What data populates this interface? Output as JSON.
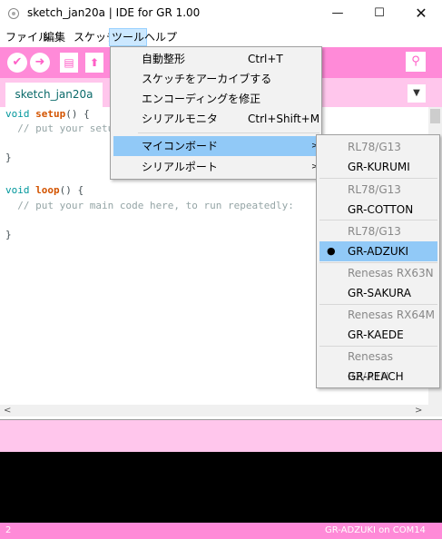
{
  "window": {
    "title": "sketch_jan20a | IDE for GR 1.00",
    "minimize_glyph": "—",
    "maximize_glyph": "☐",
    "close_glyph": "✕"
  },
  "menubar": {
    "items": [
      "ファイル",
      "編集",
      "スケッチ",
      "ツール",
      "ヘルプ"
    ],
    "active_index": 3
  },
  "toolbar": {
    "verify_glyph": "✔",
    "upload_glyph": "➜",
    "new_glyph": "▤",
    "open_glyph": "⬆",
    "serial_glyph": "⚲"
  },
  "tabs": {
    "active_tab": "sketch_jan20a",
    "menu_glyph": "▼"
  },
  "editor": {
    "lines": [
      {
        "type_kw": "void",
        "fn": "setup",
        "rest": "() {"
      },
      {
        "comment": "  // put your setup"
      },
      {
        "plain": "}"
      },
      {
        "type_kw": "void",
        "fn": "loop",
        "rest": "() {"
      },
      {
        "comment": "  // put your main code here, to run repeatedly:"
      },
      {
        "plain": "}"
      }
    ]
  },
  "tools_menu": {
    "items": [
      {
        "label": "自動整形",
        "shortcut": "Ctrl+T"
      },
      {
        "label": "スケッチをアーカイブする",
        "shortcut": ""
      },
      {
        "label": "エンコーディングを修正",
        "shortcut": ""
      },
      {
        "label": "シリアルモニタ",
        "shortcut": "Ctrl+Shift+M"
      },
      {
        "label": "マイコンボード",
        "shortcut": "",
        "submenu_arrow": ">"
      },
      {
        "label": "シリアルポート",
        "shortcut": "",
        "submenu_arrow": ">"
      }
    ],
    "highlighted_index": 4
  },
  "board_submenu": {
    "groups": [
      {
        "header": "RL78/G13",
        "board": "GR-KURUMI"
      },
      {
        "header": "RL78/G13",
        "board": "GR-COTTON"
      },
      {
        "header": "RL78/G13",
        "board": "GR-ADZUKI"
      },
      {
        "header": "Renesas RX63N",
        "board": "GR-SAKURA"
      },
      {
        "header": "Renesas RX64M",
        "board": "GR-KAEDE"
      },
      {
        "header": "Renesas RZ/A1H",
        "board": "GR-PEACH"
      }
    ],
    "selected_board": "GR-ADZUKI",
    "selected_bullet": "●"
  },
  "status": {
    "line_number": "2",
    "board_port": "GR-ADZUKI on COM14"
  },
  "colors": {
    "accent_pink": "#ff8ad8",
    "light_pink": "#ffc6ec",
    "menu_highlight": "#91c9f7"
  }
}
